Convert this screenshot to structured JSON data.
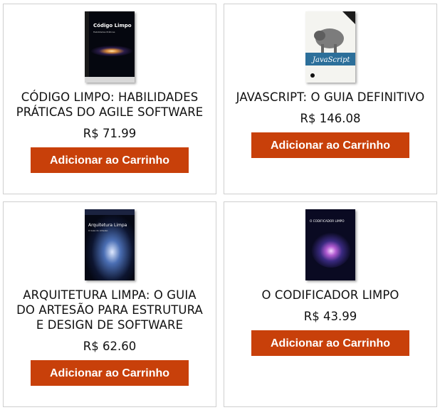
{
  "products": [
    {
      "title": "CÓDIGO LIMPO: HABILIDADES PRÁTICAS DO AGILE SOFTWARE",
      "price": "R$ 71.99",
      "button_label": "Adicionar ao Carrinho",
      "cover_text": "Código Limpo"
    },
    {
      "title": "JAVASCRIPT: O GUIA DEFINITIVO",
      "price": "R$ 146.08",
      "button_label": "Adicionar ao Carrinho",
      "cover_text": "JavaScript"
    },
    {
      "title": "ARQUITETURA LIMPA: O GUIA DO ARTESÃO PARA ESTRUTURA E DESIGN DE SOFTWARE",
      "price": "R$ 62.60",
      "button_label": "Adicionar ao Carrinho",
      "cover_text": "Arquitetura Limpa"
    },
    {
      "title": "O CODIFICADOR LIMPO",
      "price": "R$ 43.99",
      "button_label": "Adicionar ao Carrinho",
      "cover_text": "O CODIFICADOR LIMPO"
    }
  ],
  "colors": {
    "button": "#c8400a",
    "border": "#cfcfcf"
  }
}
